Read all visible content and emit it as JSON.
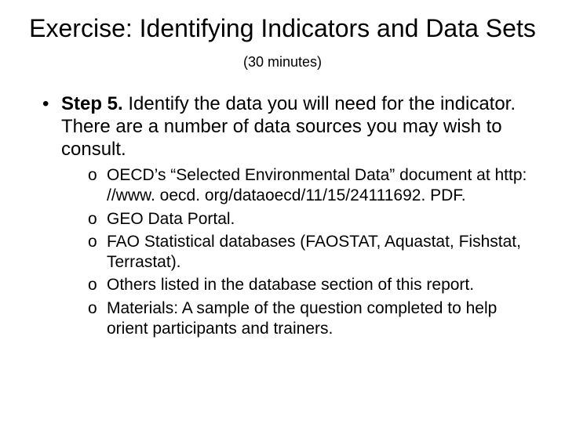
{
  "title": {
    "main": "Exercise: Identifying Indicators and Data Sets ",
    "duration": "(30 minutes)"
  },
  "body": {
    "step_label": "Step 5.",
    "step_text": " Identify the data you will need for the indicator. There are a number of data sources you may wish to consult.",
    "subitems": [
      "OECD’s “Selected Environmental Data” document at http: //www. oecd. org/dataoecd/11/15/24111692. PDF.",
      "GEO Data Portal.",
      "FAO Statistical databases (FAOSTAT, Aquastat, Fishstat, Terrastat).",
      "Others listed in the database section of this report.",
      "Materials: A sample of the question completed to help orient participants and trainers."
    ]
  }
}
